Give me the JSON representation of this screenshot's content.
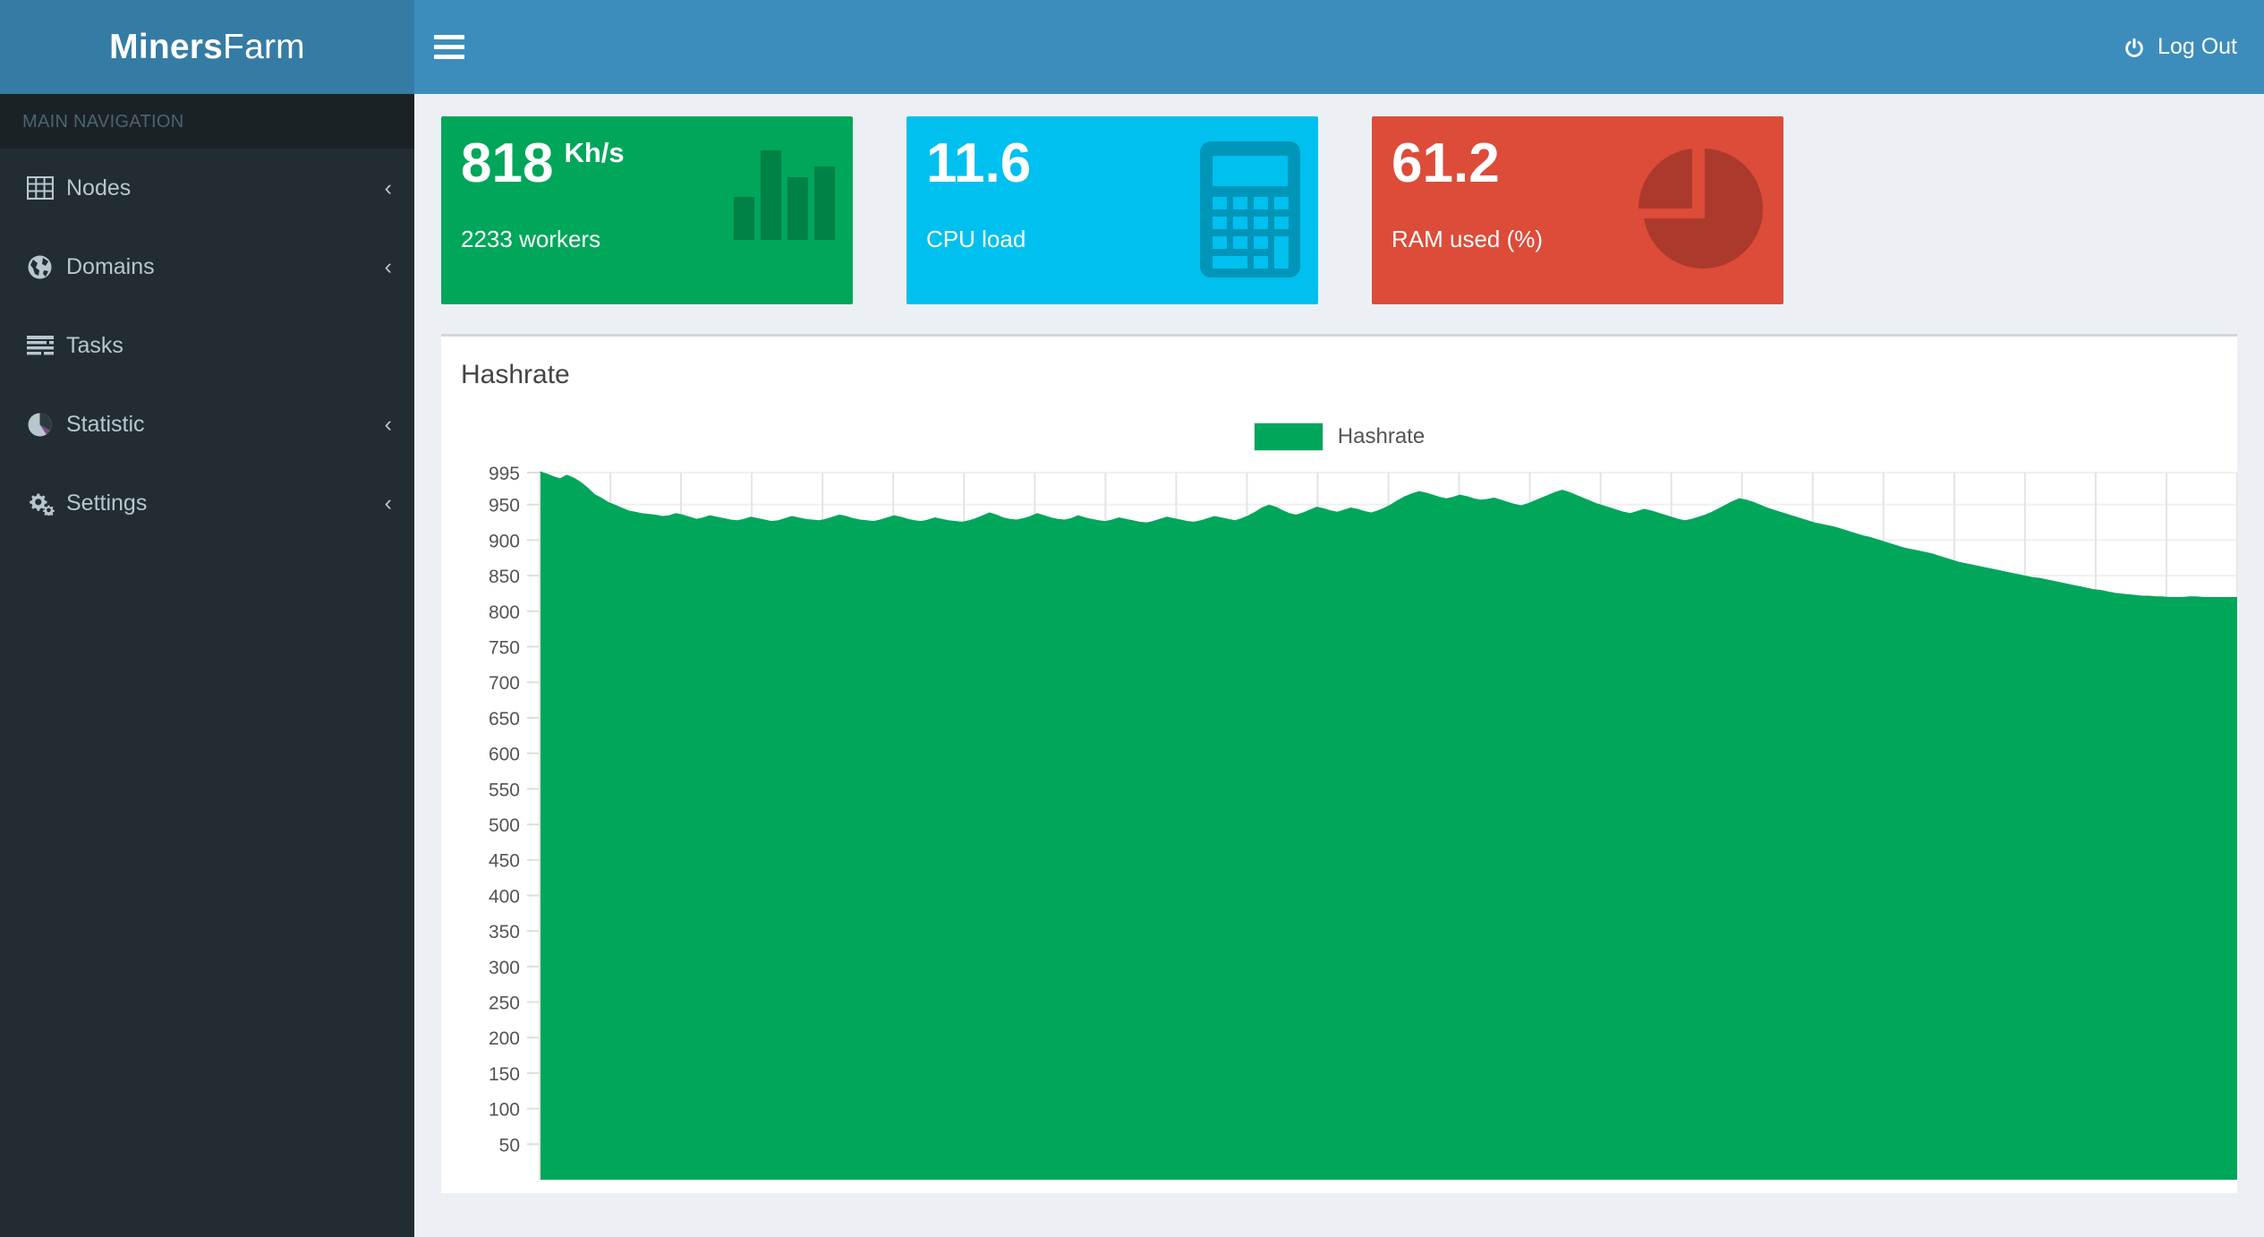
{
  "brand": {
    "strong": "Miners",
    "light": "Farm"
  },
  "navbar": {
    "menu_toggle_icon": "hamburger-icon",
    "logout_label": "Log Out",
    "logout_icon": "power-icon",
    "bg_color": "#3c8dbc",
    "logo_bg_color": "#357ca5"
  },
  "sidebar": {
    "header": "MAIN NAVIGATION",
    "bg_color": "#222d32",
    "items": [
      {
        "label": "Nodes",
        "icon": "table-grid-icon",
        "chevron": "‹",
        "has_chevron": true
      },
      {
        "label": "Domains",
        "icon": "globe-icon",
        "chevron": "‹",
        "has_chevron": true
      },
      {
        "label": "Tasks",
        "icon": "list-lines-icon",
        "chevron": "",
        "has_chevron": false
      },
      {
        "label": "Statistic",
        "icon": "pie-chart-icon",
        "chevron": "‹",
        "has_chevron": true
      },
      {
        "label": "Settings",
        "icon": "cogs-icon",
        "chevron": "‹",
        "has_chevron": true
      }
    ]
  },
  "stat_boxes": [
    {
      "value": "818",
      "unit": "Kh/s",
      "text": "2233 workers",
      "color": "#00a65a",
      "icon": "bar-chart-icon"
    },
    {
      "value": "11.6",
      "unit": "",
      "text": "CPU load",
      "color": "#00c0ef",
      "icon": "calculator-icon"
    },
    {
      "value": "61.2",
      "unit": "",
      "text": "RAM used (%)",
      "color": "#dd4b39",
      "icon": "pie-chart-icon"
    }
  ],
  "panel": {
    "title": "Hashrate",
    "legend": [
      {
        "label": "Hashrate",
        "color": "#00a65a"
      }
    ]
  },
  "chart_data": {
    "type": "area",
    "title": "Hashrate",
    "xlabel": "",
    "ylabel": "",
    "ylim": [
      0,
      995
    ],
    "grid": true,
    "legend_position": "top-center",
    "series": [
      {
        "name": "Hashrate",
        "color": "#00a65a",
        "values": [
          995,
          992,
          988,
          985,
          990,
          986,
          980,
          972,
          963,
          958,
          952,
          948,
          944,
          940,
          938,
          936,
          935,
          934,
          932,
          933,
          936,
          934,
          931,
          928,
          930,
          933,
          931,
          929,
          927,
          926,
          928,
          931,
          929,
          927,
          925,
          926,
          929,
          932,
          930,
          928,
          927,
          926,
          928,
          931,
          934,
          932,
          929,
          927,
          926,
          925,
          927,
          930,
          933,
          931,
          928,
          926,
          925,
          927,
          930,
          928,
          926,
          925,
          924,
          926,
          929,
          933,
          937,
          934,
          930,
          928,
          927,
          929,
          932,
          936,
          933,
          930,
          928,
          927,
          929,
          933,
          930,
          928,
          926,
          925,
          927,
          930,
          928,
          926,
          924,
          923,
          925,
          928,
          931,
          929,
          927,
          925,
          924,
          926,
          929,
          932,
          930,
          928,
          926,
          929,
          933,
          938,
          944,
          948,
          945,
          940,
          936,
          934,
          937,
          941,
          945,
          943,
          940,
          938,
          941,
          944,
          942,
          939,
          937,
          940,
          944,
          949,
          955,
          960,
          964,
          967,
          965,
          962,
          959,
          957,
          959,
          962,
          960,
          957,
          955,
          956,
          958,
          955,
          952,
          949,
          947,
          950,
          954,
          958,
          962,
          966,
          969,
          966,
          962,
          958,
          954,
          950,
          947,
          944,
          941,
          938,
          936,
          939,
          942,
          940,
          937,
          934,
          931,
          928,
          926,
          928,
          931,
          934,
          938,
          943,
          948,
          953,
          957,
          955,
          952,
          948,
          944,
          941,
          938,
          935,
          932,
          929,
          926,
          923,
          921,
          919,
          917,
          914,
          911,
          908,
          905,
          903,
          900,
          897,
          894,
          891,
          888,
          886,
          884,
          882,
          880,
          877,
          874,
          871,
          868,
          866,
          864,
          862,
          860,
          858,
          856,
          854,
          852,
          850,
          848,
          846,
          845,
          843,
          841,
          839,
          837,
          835,
          833,
          831,
          829,
          828,
          826,
          824,
          823,
          822,
          821,
          820,
          820,
          819,
          819,
          818,
          818,
          818,
          819,
          819,
          818,
          818,
          818,
          818,
          818,
          818
        ]
      }
    ],
    "y_ticks": [
      995,
      950,
      900,
      850,
      800,
      750,
      700,
      650,
      600,
      550,
      500,
      450,
      400,
      350,
      300,
      250,
      200,
      150,
      100,
      50
    ]
  }
}
